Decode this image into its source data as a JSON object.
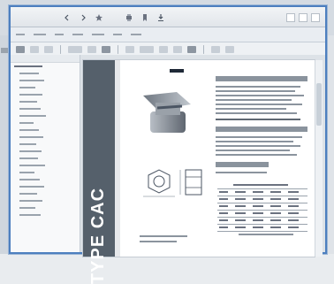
{
  "window": {
    "title": "",
    "toolbar_icons": [
      "arrow-left-icon",
      "arrow-right-icon",
      "star-icon",
      "print-icon",
      "bookmark-icon",
      "download-icon"
    ]
  },
  "menubar": {
    "items": []
  },
  "document": {
    "title_vertical": "TYPE CAC"
  },
  "colors": {
    "accent": "#4d7fbf",
    "page_left_band": "#55606b",
    "sidebar_bg": "#f8f9fa",
    "toolbar_bg": "#eef1f4"
  }
}
